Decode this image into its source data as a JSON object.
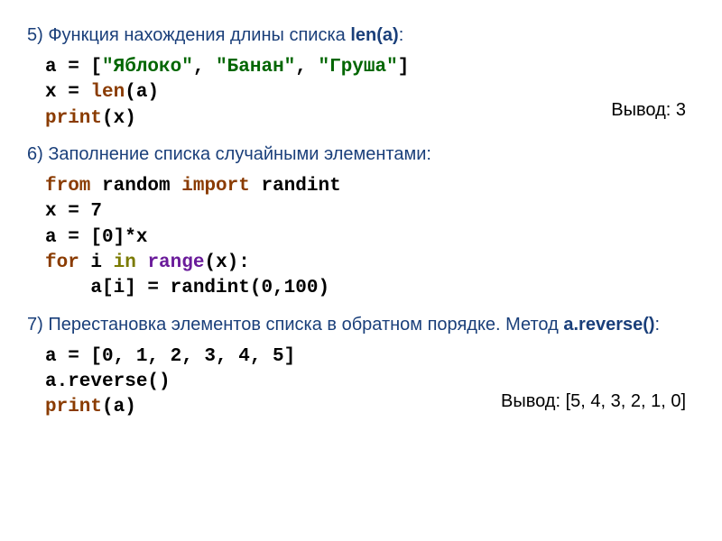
{
  "section5": {
    "title_prefix": "5) Функция нахождения длины списка ",
    "funcname": "len(a)",
    "title_suffix": ":",
    "code": {
      "line1_pre": "a = [",
      "str1": "\"Яблоко\"",
      "comma1": ", ",
      "str2": "\"Банан\"",
      "comma2": ", ",
      "str3": "\"Груша\"",
      "line1_post": "]",
      "line2_pre": "x = ",
      "len_kw": "len",
      "line2_post": "(a)",
      "line3_print": "print",
      "line3_post": "(x)"
    },
    "output_label": "Вывод: 3"
  },
  "section6": {
    "title": "6) Заполнение списка случайными элементами:",
    "code": {
      "from_kw": "from",
      "random_txt": " random ",
      "import_kw": "import",
      "randint_txt": " randint",
      "line2": "x = 7",
      "line3": "a = [0]*x",
      "for_kw": "for",
      "i_txt": " i ",
      "in_kw": "in",
      "space": " ",
      "range_kw": "range",
      "range_args": "(x):",
      "line5": "    a[i] = randint(0,100)"
    }
  },
  "section7": {
    "title_prefix": "7) Перестановка элементов списка в обратном порядке. Метод ",
    "funcname": "a.reverse()",
    "title_suffix": ":",
    "code": {
      "line1": "a = [0, 1, 2, 3, 4, 5]",
      "line2": "a.reverse()",
      "print_kw": "print",
      "print_args": "(a)"
    },
    "output_label": "Вывод: [5, 4, 3, 2, 1, 0]"
  }
}
